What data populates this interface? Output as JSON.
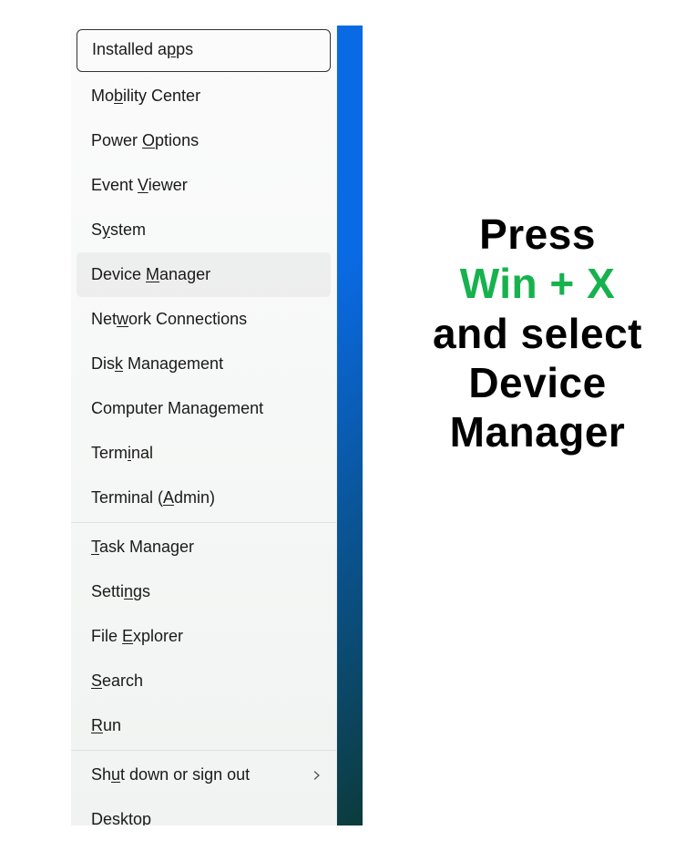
{
  "menu": {
    "groups": [
      {
        "items": [
          {
            "pre": "Installed a",
            "mn": "p",
            "post": "ps",
            "focused": true
          },
          {
            "pre": "Mo",
            "mn": "b",
            "post": "ility Center"
          },
          {
            "pre": "Power ",
            "mn": "O",
            "post": "ptions"
          },
          {
            "pre": "Event ",
            "mn": "V",
            "post": "iewer"
          },
          {
            "pre": "S",
            "mn": "y",
            "post": "stem"
          },
          {
            "pre": "Device ",
            "mn": "M",
            "post": "anager",
            "hovered": true
          },
          {
            "pre": "Net",
            "mn": "w",
            "post": "ork Connections"
          },
          {
            "pre": "Dis",
            "mn": "k",
            "post": " Management"
          },
          {
            "pre": "Computer Mana",
            "mn": "g",
            "post": "ement"
          },
          {
            "pre": "Term",
            "mn": "i",
            "post": "nal"
          },
          {
            "pre": "Terminal (",
            "mn": "A",
            "post": "dmin)"
          }
        ]
      },
      {
        "items": [
          {
            "pre": "",
            "mn": "T",
            "post": "ask Manager"
          },
          {
            "pre": "Setti",
            "mn": "n",
            "post": "gs"
          },
          {
            "pre": "File ",
            "mn": "E",
            "post": "xplorer"
          },
          {
            "pre": "",
            "mn": "S",
            "post": "earch"
          },
          {
            "pre": "",
            "mn": "R",
            "post": "un"
          }
        ]
      },
      {
        "items": [
          {
            "pre": "Sh",
            "mn": "u",
            "post": "t down or sign out",
            "submenu": true
          },
          {
            "pre": "",
            "mn": "D",
            "post": "esktop"
          }
        ]
      }
    ]
  },
  "caption": {
    "line1": "Press",
    "accent": "Win + X",
    "line3": "and select Device Manager"
  },
  "colors": {
    "accent": "#16b24d"
  }
}
